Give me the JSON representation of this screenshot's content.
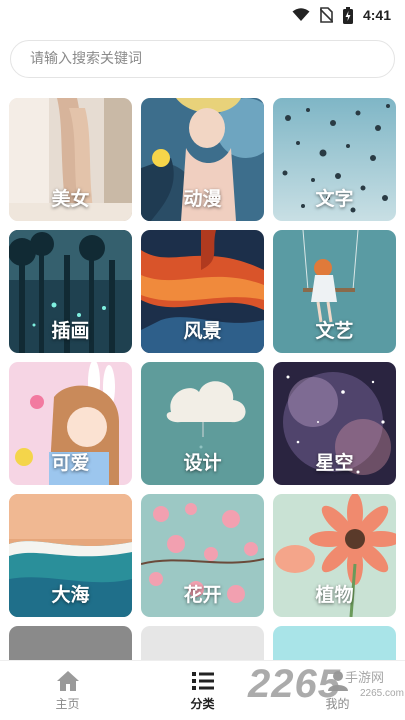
{
  "status_bar": {
    "time": "4:41"
  },
  "search": {
    "placeholder": "请输入搜索关键词",
    "value": ""
  },
  "categories": [
    {
      "label": "美女"
    },
    {
      "label": "动漫"
    },
    {
      "label": "文字"
    },
    {
      "label": "插画"
    },
    {
      "label": "风景"
    },
    {
      "label": "文艺"
    },
    {
      "label": "可爱"
    },
    {
      "label": "设计"
    },
    {
      "label": "星空"
    },
    {
      "label": "大海"
    },
    {
      "label": "花开"
    },
    {
      "label": "植物"
    }
  ],
  "bottom_nav": {
    "items": [
      {
        "label": "主页",
        "icon": "home-icon"
      },
      {
        "label": "分类",
        "icon": "list-icon"
      },
      {
        "label": "我的",
        "icon": "person-icon"
      }
    ],
    "active_index": 1
  },
  "watermark": {
    "number": "2265",
    "text": "手游网",
    "domain": "2265.com"
  }
}
